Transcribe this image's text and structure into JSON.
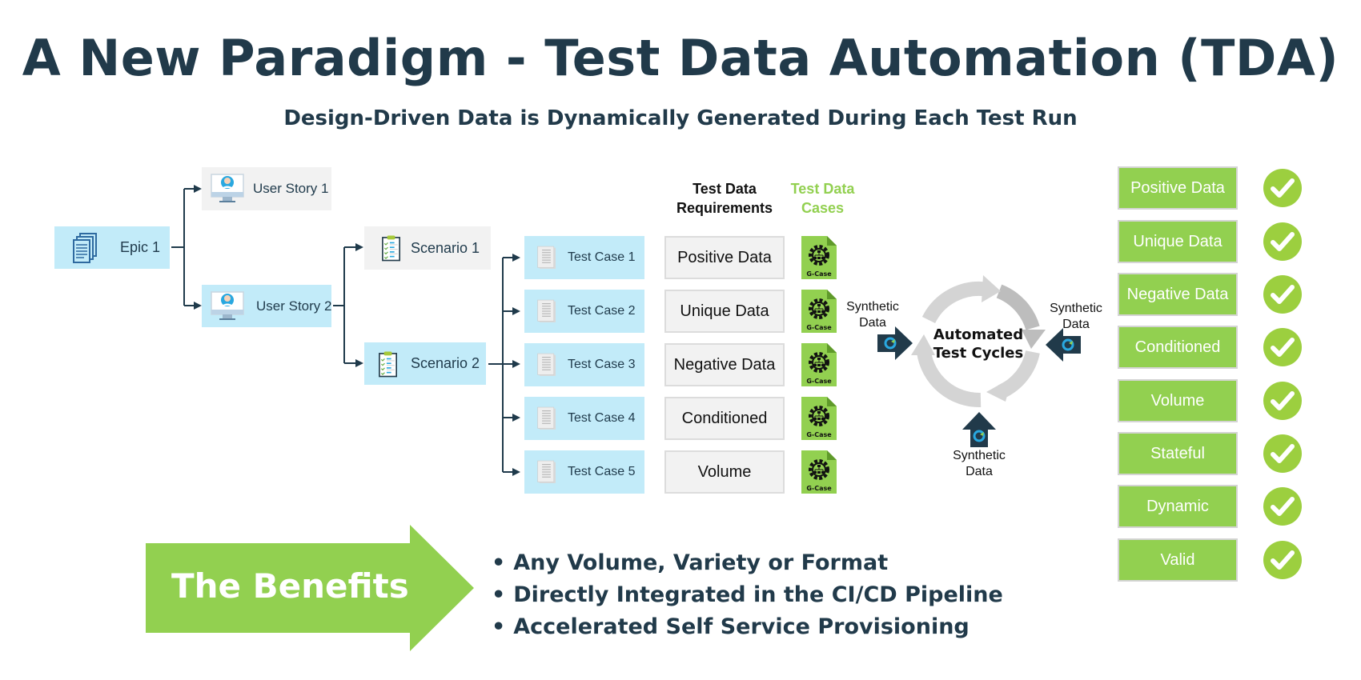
{
  "header": {
    "title": "A New Paradigm - Test Data Automation (TDA)",
    "subtitle": "Design-Driven Data is Dynamically Generated During Each Test Run"
  },
  "hierarchy": {
    "epic": {
      "label": "Epic 1",
      "icon": "documents-icon"
    },
    "user_stories": [
      {
        "label": "User Story 1",
        "icon": "user-monitor-icon",
        "highlighted": false
      },
      {
        "label": "User Story 2",
        "icon": "user-monitor-icon",
        "highlighted": true
      }
    ],
    "scenarios": [
      {
        "label": "Scenario 1",
        "icon": "clipboard-checklist-icon",
        "highlighted": false
      },
      {
        "label": "Scenario 2",
        "icon": "clipboard-checklist-icon",
        "highlighted": true
      }
    ],
    "test_cases": [
      {
        "label": "Test Case 1",
        "icon": "document-icon"
      },
      {
        "label": "Test Case 2",
        "icon": "document-icon"
      },
      {
        "label": "Test Case 3",
        "icon": "document-icon"
      },
      {
        "label": "Test Case 4",
        "icon": "document-icon"
      },
      {
        "label": "Test Case 5",
        "icon": "document-icon"
      }
    ]
  },
  "requirements": {
    "header_line1": "Test Data",
    "header_line2": "Requirements",
    "items": [
      "Positive Data",
      "Unique Data",
      "Negative Data",
      "Conditioned",
      "Volume"
    ]
  },
  "data_cases": {
    "header_line1": "Test Data",
    "header_line2": "Cases",
    "file_label": "G-Case",
    "count": 5
  },
  "cycle": {
    "label_line1": "Automated",
    "label_line2": "Test Cycles",
    "inputs": [
      {
        "line1": "Synthetic",
        "line2": "Data",
        "side": "left"
      },
      {
        "line1": "Synthetic",
        "line2": "Data",
        "side": "right"
      },
      {
        "line1": "Synthetic",
        "line2": "Data",
        "side": "bottom"
      }
    ]
  },
  "outcomes": [
    {
      "label": "Positive Data",
      "status": "check"
    },
    {
      "label": "Unique Data",
      "status": "check"
    },
    {
      "label": "Negative Data",
      "status": "check"
    },
    {
      "label": "Conditioned",
      "status": "check"
    },
    {
      "label": "Volume",
      "status": "check"
    },
    {
      "label": "Stateful",
      "status": "check"
    },
    {
      "label": "Dynamic",
      "status": "check"
    },
    {
      "label": "Valid",
      "status": "check"
    }
  ],
  "benefits": {
    "label": "The Benefits",
    "items": [
      "Any Volume, Variety or Format",
      "Directly Integrated in the CI/CD Pipeline",
      "Accelerated Self Service Provisioning"
    ]
  },
  "colors": {
    "title": "#213a4a",
    "node_blue": "#c2ebf9",
    "node_grey": "#f2f2f2",
    "accent_green": "#92d050",
    "connector": "#1f3a4b",
    "cycle_grey": "#cfcfcf"
  }
}
